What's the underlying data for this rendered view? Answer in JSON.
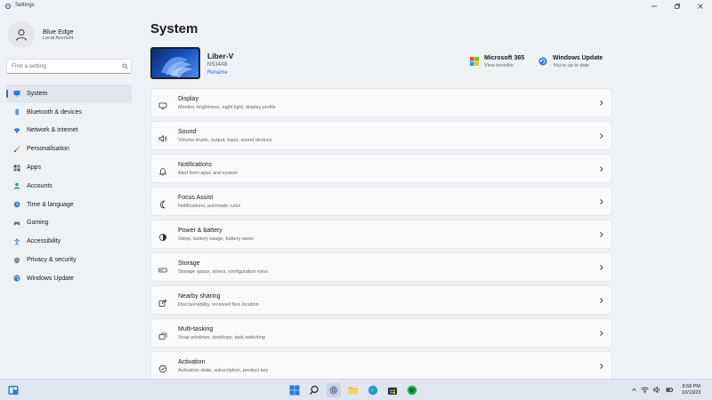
{
  "window": {
    "title": "Settings"
  },
  "user": {
    "name": "Blue Edge",
    "account_type": "Local Account"
  },
  "search": {
    "placeholder": "Find a setting"
  },
  "sidebar": {
    "items": [
      {
        "label": "System",
        "icon": "system-icon",
        "active": true
      },
      {
        "label": "Bluetooth & devices",
        "icon": "bluetooth-icon"
      },
      {
        "label": "Network & internet",
        "icon": "wifi-icon"
      },
      {
        "label": "Personalisation",
        "icon": "brush-icon"
      },
      {
        "label": "Apps",
        "icon": "apps-icon"
      },
      {
        "label": "Accounts",
        "icon": "accounts-icon"
      },
      {
        "label": "Time & language",
        "icon": "globe-clock-icon"
      },
      {
        "label": "Gaming",
        "icon": "gamepad-icon"
      },
      {
        "label": "Accessibility",
        "icon": "accessibility-icon"
      },
      {
        "label": "Privacy & security",
        "icon": "shield-icon"
      },
      {
        "label": "Windows Update",
        "icon": "update-icon"
      }
    ]
  },
  "main": {
    "title": "System",
    "device": {
      "name": "Liber-V",
      "model": "NS14A8",
      "rename_label": "Rename"
    },
    "quick_links": [
      {
        "title": "Microsoft 365",
        "subtitle": "View benefits",
        "icon": "microsoft365-icon"
      },
      {
        "title": "Windows Update",
        "subtitle": "You're up to date",
        "icon": "update-icon"
      }
    ],
    "cards": [
      {
        "title": "Display",
        "subtitle": "Monitor, brightness, night light, display profile",
        "icon": "display-icon"
      },
      {
        "title": "Sound",
        "subtitle": "Volume levels, output, input, sound devices",
        "icon": "speaker-icon"
      },
      {
        "title": "Notifications",
        "subtitle": "Alert from apps and system",
        "icon": "bell-icon"
      },
      {
        "title": "Focus Assist",
        "subtitle": "Notifications, automatic rules",
        "icon": "moon-icon"
      },
      {
        "title": "Power & battery",
        "subtitle": "Sleep, battery usage, battery saver",
        "icon": "power-icon"
      },
      {
        "title": "Storage",
        "subtitle": "Storage space, drives, configuration rules",
        "icon": "storage-icon"
      },
      {
        "title": "Nearby sharing",
        "subtitle": "Discoverability, received files location",
        "icon": "share-icon"
      },
      {
        "title": "Multi-tasking",
        "subtitle": "Snap windows, desktops, task switching",
        "icon": "multitask-icon"
      },
      {
        "title": "Activation",
        "subtitle": "Activation state, subscription, product key",
        "icon": "check-circle-icon"
      }
    ]
  },
  "taskbar": {
    "apps": [
      "start-icon",
      "search-icon",
      "settings-icon",
      "file-explorer-icon",
      "edge-icon",
      "store-icon",
      "spotify-icon"
    ],
    "time": "8:58 PM",
    "date": "10/19/23"
  },
  "colors": {
    "accent": "#1f6fd1",
    "background": "#eef1f6",
    "card": "#f9fafb"
  }
}
